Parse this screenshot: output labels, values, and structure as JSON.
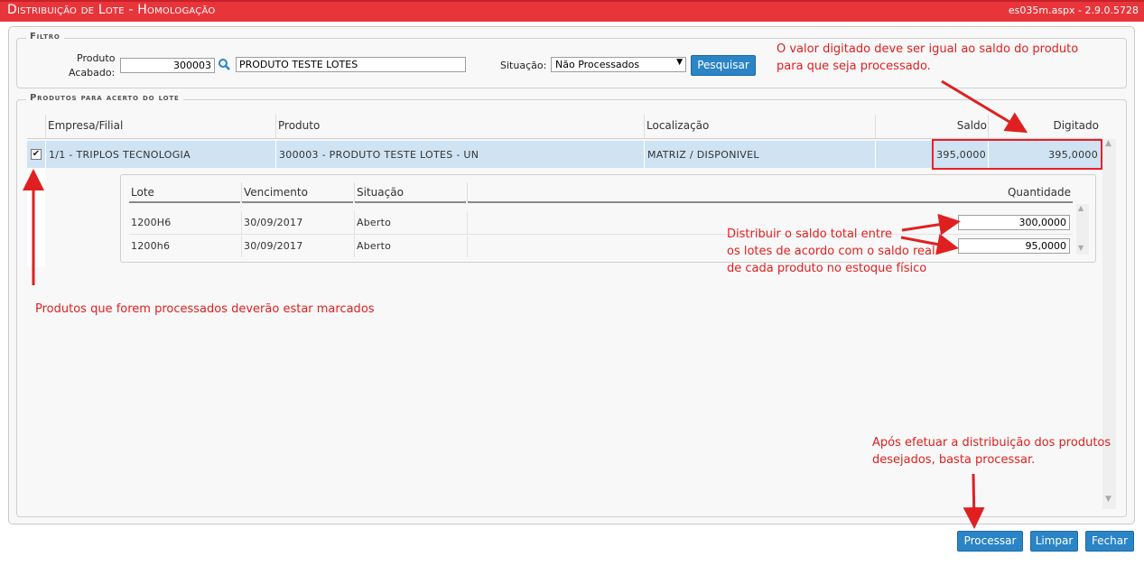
{
  "header": {
    "title": "Distribuição de Lote  - Homologação",
    "version": "es035m.aspx - 2.9.0.5728"
  },
  "filtro": {
    "legend": "Filtro",
    "produto_label_1": "Produto",
    "produto_label_2": "Acabado:",
    "produto_code": "300003",
    "produto_desc": "PRODUTO TESTE LOTES",
    "situacao_label": "Situação:",
    "situacao_value": "Não Processados",
    "pesquisar_label": "Pesquisar"
  },
  "produtos": {
    "legend": "Produtos para acerto do lote",
    "columns": [
      "Empresa/Filial",
      "Produto",
      "Localização",
      "Saldo",
      "Digitado"
    ],
    "rows": [
      {
        "checked": true,
        "empresa": "1/1 - TRIPLOS TECNOLOGIA",
        "produto": "300003 - PRODUTO TESTE LOTES - UN",
        "localizacao": "MATRIZ / DISPONIVEL",
        "saldo": "395,0000",
        "digitado": "395,0000"
      }
    ]
  },
  "lotes": {
    "columns": [
      "Lote",
      "Vencimento",
      "Situação",
      "Quantidade"
    ],
    "rows": [
      {
        "lote": "1200H6",
        "vencimento": "30/09/2017",
        "situacao": "Aberto",
        "quantidade": "300,0000"
      },
      {
        "lote": "1200h6",
        "vencimento": "30/09/2017",
        "situacao": "Aberto",
        "quantidade": "95,0000"
      }
    ]
  },
  "annotations": {
    "top_right_1": "O valor digitado deve ser igual ao saldo do produto",
    "top_right_2": "para que seja processado.",
    "middle_1": "Distribuir o saldo total entre",
    "middle_2": "os lotes de acordo com o saldo real",
    "middle_3": "de cada produto no estoque físico",
    "left": "Produtos que forem processados deverão estar marcados",
    "bottom_1": "Após efetuar a distribuição dos produtos",
    "bottom_2": "desejados, basta processar."
  },
  "footer": {
    "processar_label": "Processar",
    "limpar_label": "Limpar",
    "fechar_label": "Fechar"
  },
  "colors": {
    "title_bar": "#e8353a",
    "button": "#2a84c6",
    "selected_row": "#cfe3f3",
    "annotation": "#e02020"
  }
}
